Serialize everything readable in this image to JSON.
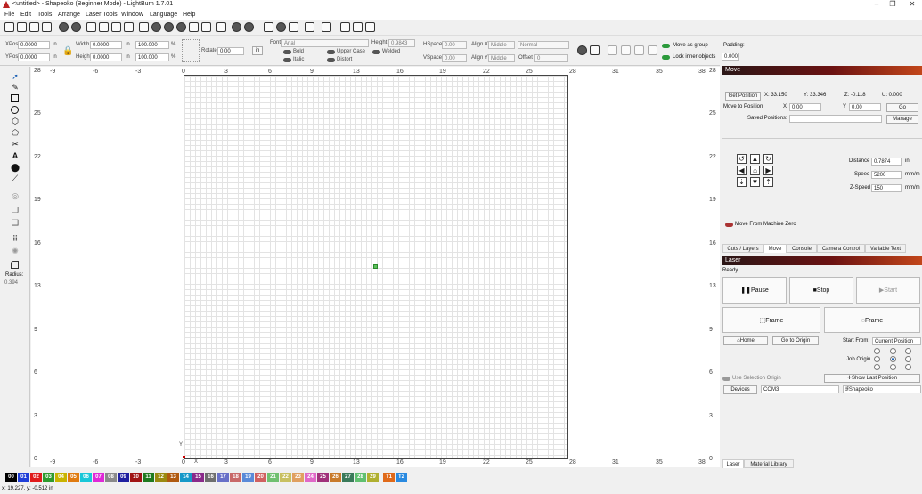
{
  "window": {
    "title": "<untitled> - Shapeoko (Beginner Mode) - LightBurn 1.7.01",
    "minimize": "–",
    "maximize": "❐",
    "close": "✕"
  },
  "menu": [
    "File",
    "Edit",
    "Tools",
    "Arrange",
    "Laser Tools",
    "Window",
    "Language",
    "Help"
  ],
  "props": {
    "xpos_label": "XPos",
    "xpos": "0.0000",
    "ypos_label": "YPos",
    "ypos": "0.0000",
    "unit_in": "in",
    "width_label": "Width",
    "width": "0.0000",
    "height_label": "Height",
    "height": "0.0000",
    "pct_w": "100.000",
    "pct_h": "100.000",
    "pct": "%",
    "rotate_label": "Rotate",
    "rotate": "0.00",
    "rot_unit": "in",
    "font_label": "Font",
    "font": "Arial",
    "bold": "Bold",
    "italic": "Italic",
    "upper_case": "Upper Case",
    "distort": "Distort",
    "welded": "Welded",
    "fheight_label": "Height",
    "fheight": "0.9843",
    "hspace_label": "HSpace",
    "hspace": "0.00",
    "vspace_label": "VSpace",
    "vspace": "0.00",
    "alignx_label": "Align X",
    "alignx": "Middle",
    "aligny_label": "Align Y",
    "aligny": "Middle",
    "normal": "Normal",
    "offset_label": "Offset",
    "offset": "0",
    "move_as_group": "Move as group",
    "lock_inner": "Lock inner objects",
    "padding_label": "Padding:",
    "padding": "0.000"
  },
  "left_tools": {
    "radius_label": "Radius:",
    "radius": "0.394",
    "text_tool": "A"
  },
  "axes": {
    "x_top": [
      "-9",
      "-6",
      "-3",
      "0",
      "3",
      "6",
      "9",
      "13",
      "16",
      "19",
      "22",
      "25",
      "28",
      "31",
      "35",
      "38"
    ],
    "x_bottom": [
      "-9",
      "-6",
      "-3",
      "0",
      "X",
      "3",
      "6",
      "9",
      "13",
      "16",
      "19",
      "22",
      "25",
      "28",
      "31",
      "35",
      "38"
    ],
    "y_left": [
      "28",
      "25",
      "22",
      "19",
      "16",
      "13",
      "9",
      "6",
      "3",
      "0"
    ],
    "y_right": [
      "28",
      "25",
      "22",
      "19",
      "16",
      "13",
      "9",
      "6",
      "3",
      "0"
    ],
    "y_marker": "Y"
  },
  "move_panel": {
    "title": "Move",
    "get_position": "Get Position",
    "x_readout": "X: 33.150",
    "y_readout": "Y: 33.346",
    "z_readout": "Z: -0.118",
    "u_readout": "U: 0.000",
    "move_to_position": "Move to Position",
    "x_label": "X",
    "x_val": "0.00",
    "y_label": "Y",
    "y_val": "0.00",
    "go": "Go",
    "saved_positions": "Saved Positions:",
    "manage": "Manage",
    "distance_label": "Distance",
    "distance": "0.7874",
    "distance_unit": "in",
    "speed_label": "Speed",
    "speed": "5200",
    "speed_unit": "mm/m",
    "zspeed_label": "Z-Speed",
    "zspeed": "150",
    "zspeed_unit": "mm/m",
    "move_from_zero": "Move From Machine Zero"
  },
  "tabs1": [
    "Cuts / Layers",
    "Move",
    "Console",
    "Camera Control",
    "Variable Text"
  ],
  "laser_panel": {
    "title": "Laser",
    "status": "Ready",
    "pause": "Pause",
    "stop": "Stop",
    "start": "Start",
    "frame1": "Frame",
    "frame2": "Frame",
    "home": "Home",
    "go_to_origin": "Go to Origin",
    "start_from_label": "Start From:",
    "start_from": "Current Position",
    "job_origin": "Job Origin",
    "use_selection_origin": "Use Selection Origin",
    "show_last_position": "Show Last Position",
    "devices": "Devices",
    "port": "COM3",
    "machine": "Shapeoko"
  },
  "tabs2": [
    "Laser",
    "Material Library"
  ],
  "palette": [
    {
      "label": "00",
      "color": "#000000"
    },
    {
      "label": "01",
      "color": "#1f3fd8"
    },
    {
      "label": "02",
      "color": "#e01b1b"
    },
    {
      "label": "03",
      "color": "#2e9a2e"
    },
    {
      "label": "04",
      "color": "#c9b400"
    },
    {
      "label": "05",
      "color": "#e07b10"
    },
    {
      "label": "06",
      "color": "#19c7d8"
    },
    {
      "label": "07",
      "color": "#e028d8"
    },
    {
      "label": "08",
      "color": "#8a8a8a"
    },
    {
      "label": "09",
      "color": "#2020a0"
    },
    {
      "label": "10",
      "color": "#a01414"
    },
    {
      "label": "11",
      "color": "#1f7a1f"
    },
    {
      "label": "12",
      "color": "#9a8a10"
    },
    {
      "label": "13",
      "color": "#b05a10"
    },
    {
      "label": "14",
      "color": "#1698c8"
    },
    {
      "label": "15",
      "color": "#8a2a8a"
    },
    {
      "label": "16",
      "color": "#6e6e6e"
    },
    {
      "label": "17",
      "color": "#6870c8"
    },
    {
      "label": "18",
      "color": "#c86868"
    },
    {
      "label": "19",
      "color": "#5a8ad8"
    },
    {
      "label": "20",
      "color": "#d06060"
    },
    {
      "label": "21",
      "color": "#70c070"
    },
    {
      "label": "22",
      "color": "#c8c060"
    },
    {
      "label": "23",
      "color": "#e0a060"
    },
    {
      "label": "24",
      "color": "#e068c8"
    },
    {
      "label": "25",
      "color": "#a0307a"
    },
    {
      "label": "26",
      "color": "#c87a2a"
    },
    {
      "label": "27",
      "color": "#3a7a5a"
    },
    {
      "label": "28",
      "color": "#60c070"
    },
    {
      "label": "29",
      "color": "#b0b030"
    },
    {
      "label": "T1",
      "color": "#e06a1a"
    },
    {
      "label": "T2",
      "color": "#2a8ae0"
    }
  ],
  "status_bar": "x: 19.227, y: -0.512 in"
}
